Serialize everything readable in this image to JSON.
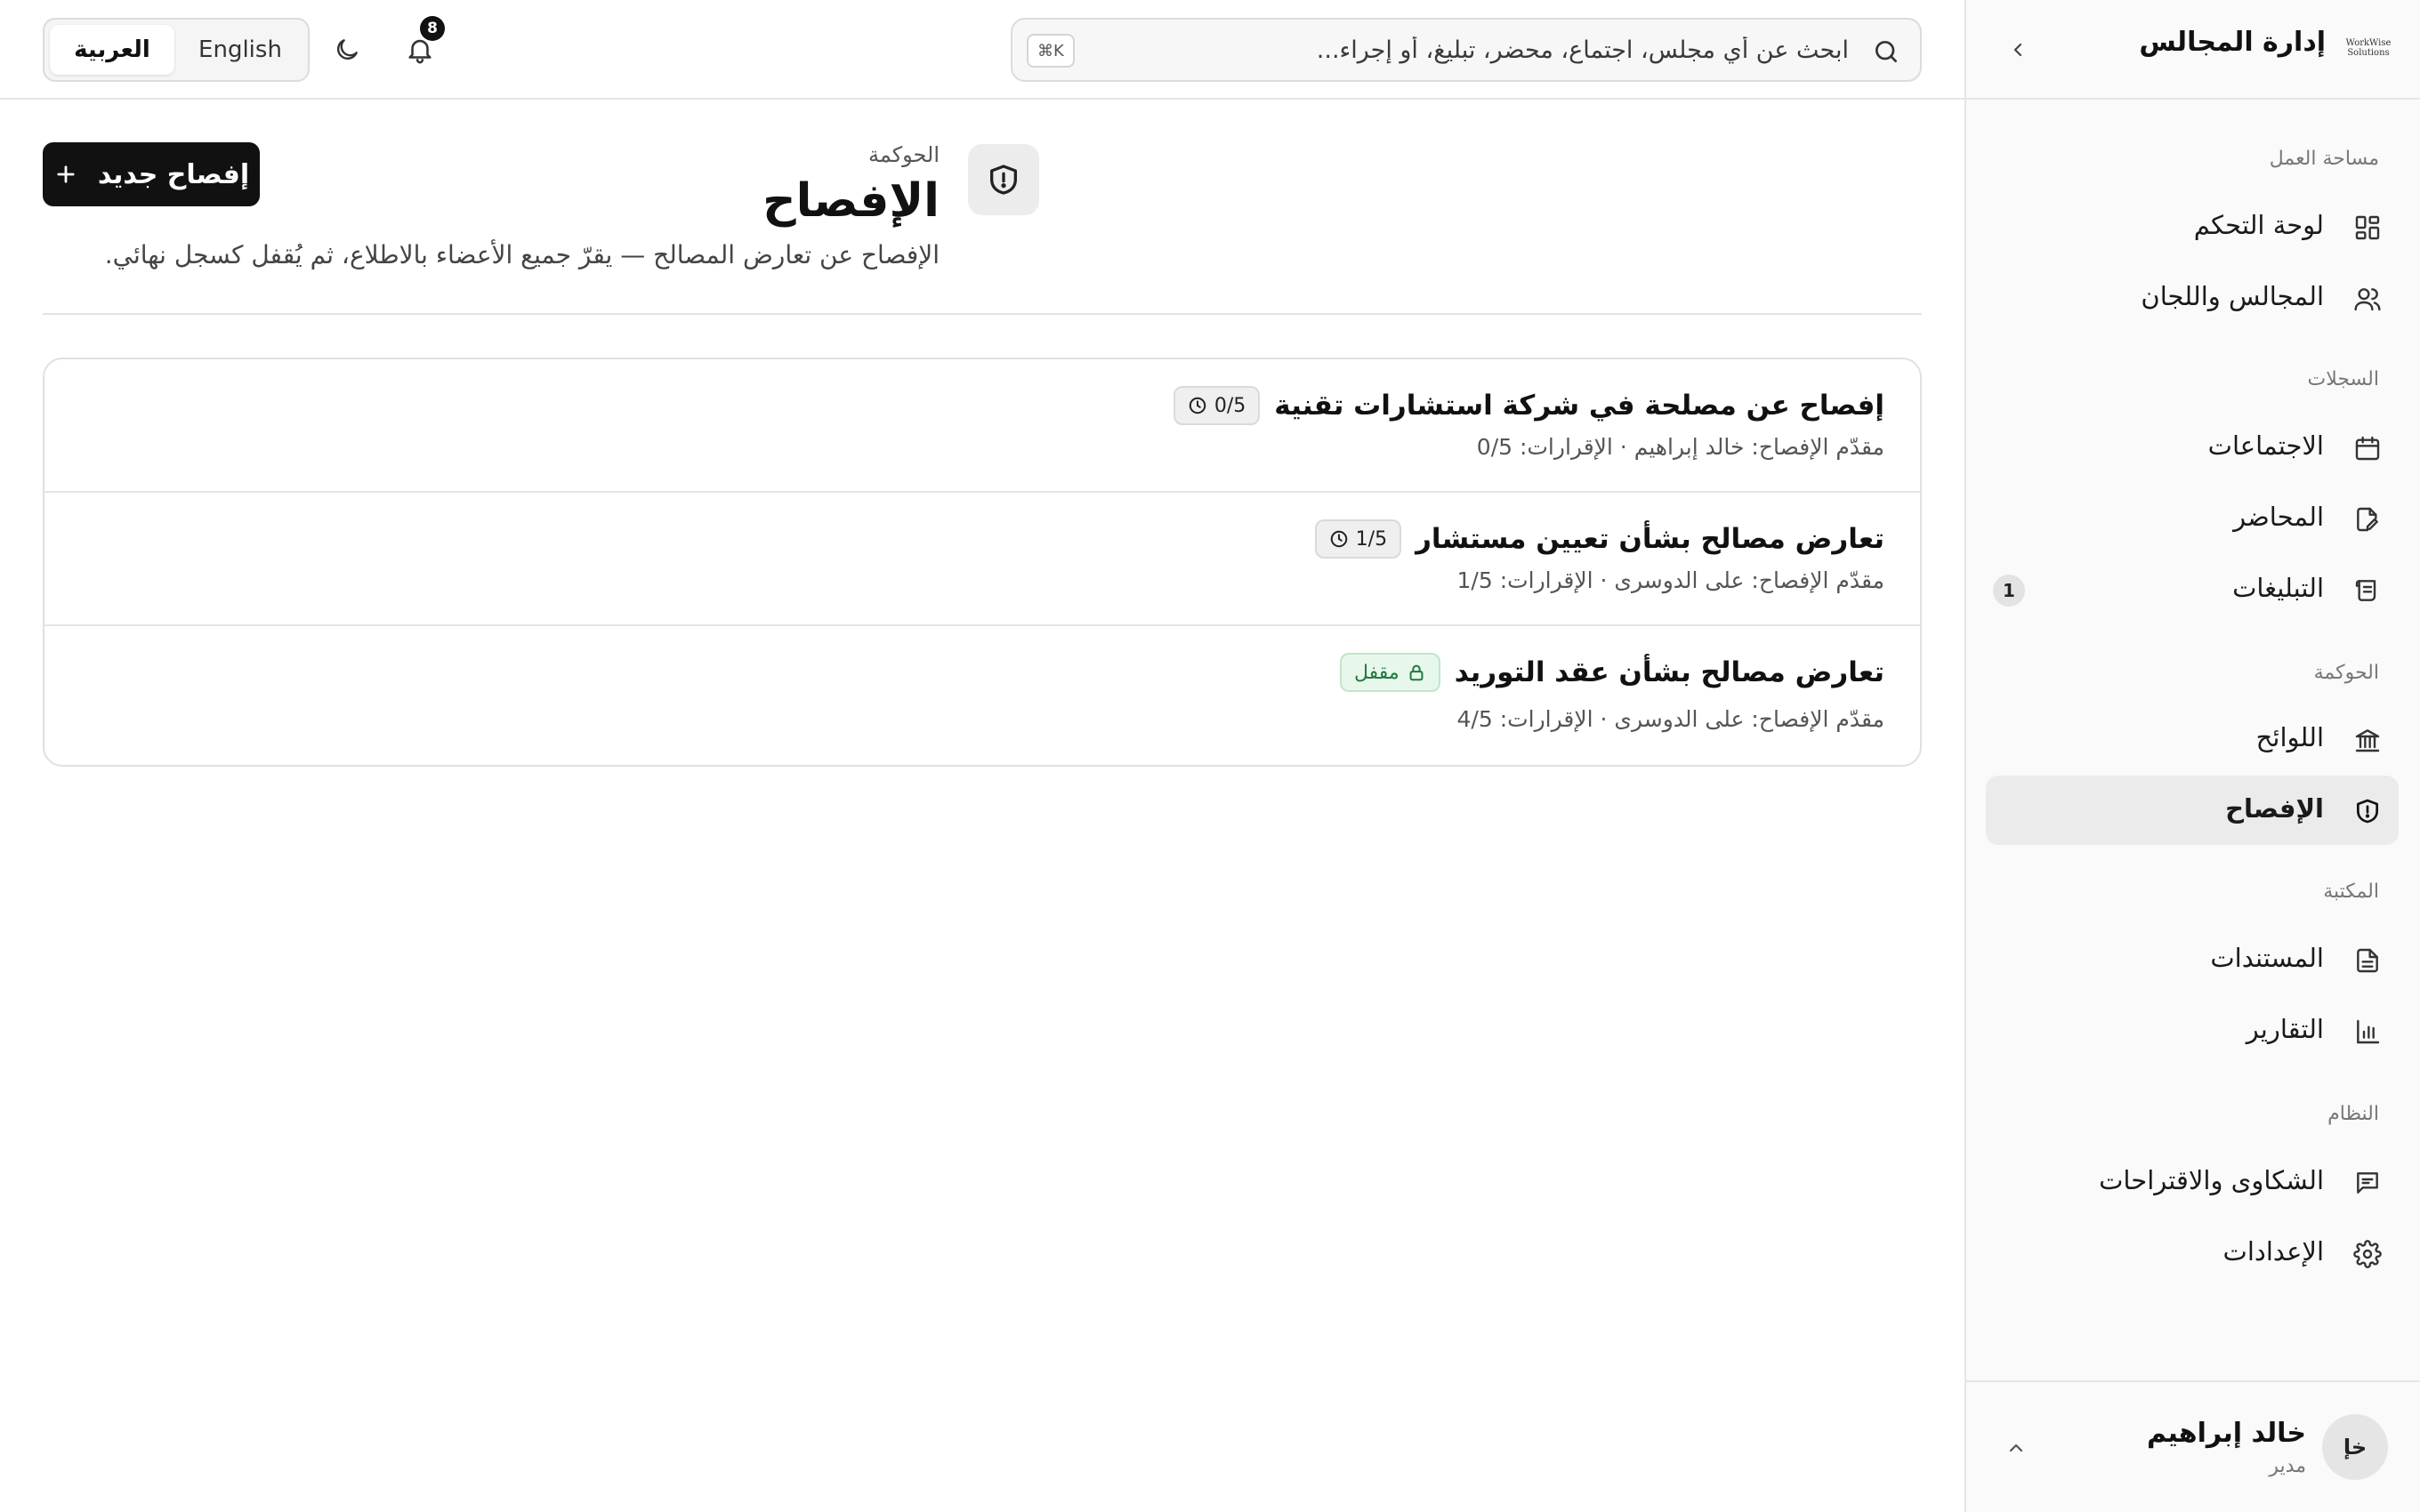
{
  "brand": {
    "logo_line1": "WorkWise",
    "logo_line2": "Solutions",
    "title": "إدارة المجالس"
  },
  "sidebar": {
    "sections": [
      {
        "label": "مساحة العمل",
        "items": [
          {
            "label": "لوحة التحكم",
            "icon": "dashboard-icon"
          },
          {
            "label": "المجالس واللجان",
            "icon": "users-icon"
          }
        ]
      },
      {
        "label": "السجلات",
        "items": [
          {
            "label": "الاجتماعات",
            "icon": "calendar-icon"
          },
          {
            "label": "المحاضر",
            "icon": "edit-document-icon"
          },
          {
            "label": "التبليغات",
            "icon": "scroll-icon",
            "badge": "1"
          }
        ]
      },
      {
        "label": "الحوكمة",
        "items": [
          {
            "label": "اللوائح",
            "icon": "bank-icon"
          },
          {
            "label": "الإفصاح",
            "icon": "shield-alert-icon",
            "active": true
          }
        ]
      },
      {
        "label": "المكتبة",
        "items": [
          {
            "label": "المستندات",
            "icon": "file-text-icon"
          },
          {
            "label": "التقارير",
            "icon": "bar-chart-icon"
          }
        ]
      },
      {
        "label": "النظام",
        "items": [
          {
            "label": "الشكاوى والاقتراحات",
            "icon": "message-icon"
          },
          {
            "label": "الإعدادات",
            "icon": "gear-icon"
          }
        ]
      }
    ]
  },
  "user": {
    "initials": "خإ",
    "name": "خالد إبراهيم",
    "role": "مدير"
  },
  "topbar": {
    "search_placeholder": "ابحث عن أي مجلس، اجتماع، محضر، تبليغ، أو إجراء...",
    "shortcut": "⌘K",
    "notification_count": "8",
    "lang_en": "English",
    "lang_ar": "العربية"
  },
  "page": {
    "breadcrumb": "الحوكمة",
    "title": "الإفصاح",
    "description": "الإفصاح عن تعارض المصالح — يقرّ جميع الأعضاء بالاطلاع، ثم يُقفل كسجل نهائي.",
    "new_button": "إفصاح جديد"
  },
  "disclosures": [
    {
      "title": "إفصاح عن مصلحة في شركة استشارات تقنية",
      "status": "pending",
      "status_label": "0/5",
      "meta": "مقدّم الإفصاح: خالد إبراهيم · الإقرارات: 0/5"
    },
    {
      "title": "تعارض مصالح بشأن تعيين مستشار",
      "status": "pending",
      "status_label": "1/5",
      "meta": "مقدّم الإفصاح: على الدوسرى · الإقرارات: 1/5"
    },
    {
      "title": "تعارض مصالح بشأن عقد التوريد",
      "status": "locked",
      "status_label": "مقفل",
      "meta": "مقدّم الإفصاح: على الدوسرى · الإقرارات: 4/5"
    }
  ],
  "colors": {
    "primary": "#111111",
    "locked_bg": "#e7f7ec",
    "locked_text": "#1f7a3d",
    "active_nav": "#ebebeb"
  }
}
